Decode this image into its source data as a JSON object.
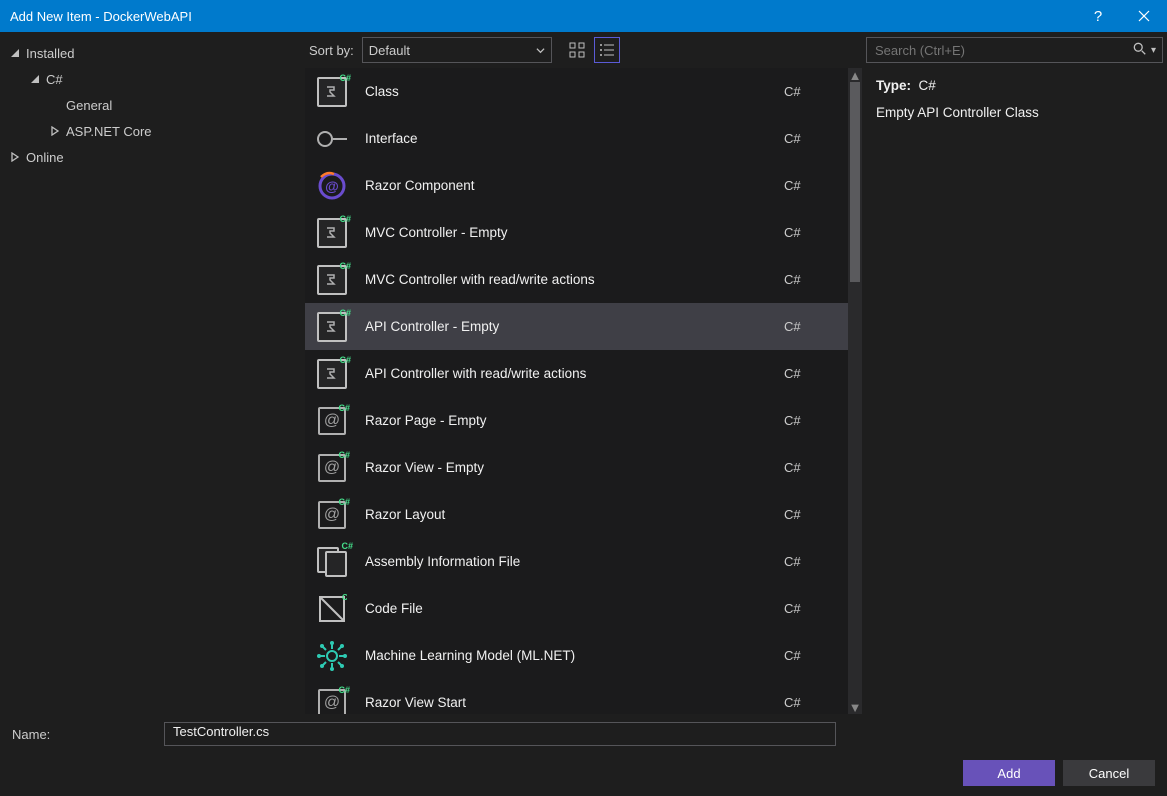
{
  "titlebar": {
    "title": "Add New Item - DockerWebAPI"
  },
  "sidebar": {
    "items": [
      {
        "label": "Installed",
        "indent": 0,
        "expanded": true
      },
      {
        "label": "C#",
        "indent": 1,
        "expanded": true
      },
      {
        "label": "General",
        "indent": 2,
        "expanded": null
      },
      {
        "label": "ASP.NET Core",
        "indent": 2,
        "expanded": false
      },
      {
        "label": "Online",
        "indent": 0,
        "expanded": false
      }
    ]
  },
  "toolbar": {
    "sort_label": "Sort by:",
    "sort_value": "Default"
  },
  "items": [
    {
      "name": "Class",
      "tag": "C#",
      "icon": "cs-class",
      "selected": false
    },
    {
      "name": "Interface",
      "tag": "C#",
      "icon": "interface",
      "selected": false
    },
    {
      "name": "Razor Component",
      "tag": "C#",
      "icon": "razor-comp",
      "selected": false
    },
    {
      "name": "MVC Controller - Empty",
      "tag": "C#",
      "icon": "cs-class",
      "selected": false
    },
    {
      "name": "MVC Controller with read/write actions",
      "tag": "C#",
      "icon": "cs-class",
      "selected": false
    },
    {
      "name": "API Controller - Empty",
      "tag": "C#",
      "icon": "cs-class",
      "selected": true
    },
    {
      "name": "API Controller with read/write actions",
      "tag": "C#",
      "icon": "cs-class",
      "selected": false
    },
    {
      "name": "Razor Page - Empty",
      "tag": "C#",
      "icon": "razor-page",
      "selected": false
    },
    {
      "name": "Razor View - Empty",
      "tag": "C#",
      "icon": "razor-page",
      "selected": false
    },
    {
      "name": "Razor Layout",
      "tag": "C#",
      "icon": "razor-page",
      "selected": false
    },
    {
      "name": "Assembly Information File",
      "tag": "C#",
      "icon": "asm-file",
      "selected": false
    },
    {
      "name": "Code File",
      "tag": "C#",
      "icon": "code-file",
      "selected": false
    },
    {
      "name": "Machine Learning Model (ML.NET)",
      "tag": "C#",
      "icon": "ml-net",
      "selected": false
    },
    {
      "name": "Razor View Start",
      "tag": "C#",
      "icon": "razor-page",
      "selected": false
    }
  ],
  "search": {
    "placeholder": "Search (Ctrl+E)"
  },
  "details": {
    "type_label": "Type:",
    "type_value": "C#",
    "description": "Empty API Controller Class"
  },
  "bottom": {
    "name_label": "Name:",
    "name_value": "TestController.cs",
    "add_label": "Add",
    "cancel_label": "Cancel"
  }
}
